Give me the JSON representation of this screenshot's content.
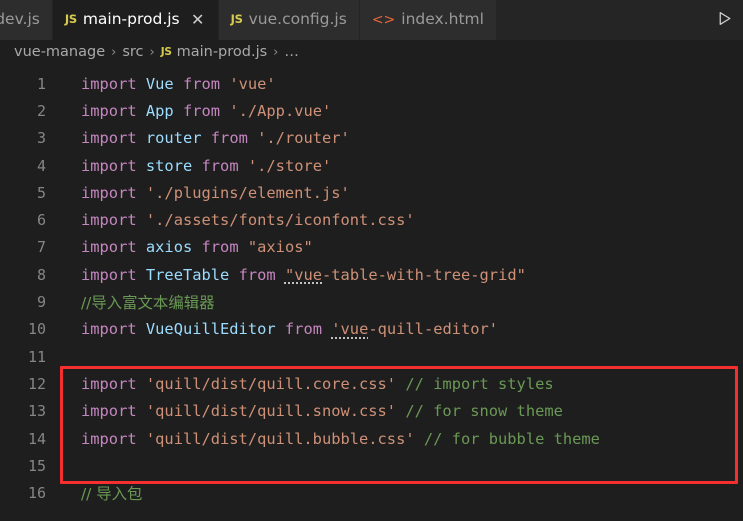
{
  "window": {
    "app": "Visual Studio Code",
    "background": "#1e1e1e"
  },
  "tabbar": {
    "background": "#252526",
    "tabs": [
      {
        "label": "ain-dev.js",
        "icon": "js-file-icon",
        "icon_text": "JS",
        "active": false,
        "clipped": true,
        "closable": false
      },
      {
        "label": "main-prod.js",
        "icon": "js-file-icon",
        "icon_text": "JS",
        "active": true,
        "clipped": false,
        "closable": true
      },
      {
        "label": "vue.config.js",
        "icon": "js-file-icon",
        "icon_text": "JS",
        "active": false,
        "clipped": false,
        "closable": false
      },
      {
        "label": "index.html",
        "icon": "html-file-icon",
        "icon_text": "<>",
        "active": false,
        "clipped": false,
        "closable": false
      }
    ],
    "close_glyph": "✕",
    "run_button_label": "Run",
    "run_icon": "play-triangle-icon"
  },
  "breadcrumb": {
    "separator": "›",
    "items": [
      {
        "label": "vue-manage",
        "icon": null
      },
      {
        "label": "src",
        "icon": null
      },
      {
        "label": "main-prod.js",
        "icon": "js-file-icon",
        "icon_text": "JS"
      },
      {
        "label": "…",
        "icon": null
      }
    ]
  },
  "editor": {
    "language": "javascript",
    "first_visible_line": 1,
    "last_visible_line": 16,
    "colors": {
      "keyword": "#c586c0",
      "variable": "#9cdcfe",
      "string": "#ce9178",
      "comment": "#6a9955",
      "plain": "#d4d4d4",
      "line_number": "#868686",
      "background": "#1e1e1e"
    },
    "lines": [
      {
        "n": "1",
        "tokens": [
          {
            "t": "import",
            "c": "kw"
          },
          {
            "t": " ",
            "c": "plain"
          },
          {
            "t": "Vue",
            "c": "var"
          },
          {
            "t": " ",
            "c": "plain"
          },
          {
            "t": "from",
            "c": "kw"
          },
          {
            "t": " ",
            "c": "plain"
          },
          {
            "t": "'vue'",
            "c": "str"
          }
        ]
      },
      {
        "n": "2",
        "tokens": [
          {
            "t": "import",
            "c": "kw"
          },
          {
            "t": " ",
            "c": "plain"
          },
          {
            "t": "App",
            "c": "var"
          },
          {
            "t": " ",
            "c": "plain"
          },
          {
            "t": "from",
            "c": "kw"
          },
          {
            "t": " ",
            "c": "plain"
          },
          {
            "t": "'./App.vue'",
            "c": "str"
          }
        ]
      },
      {
        "n": "3",
        "tokens": [
          {
            "t": "import",
            "c": "kw"
          },
          {
            "t": " ",
            "c": "plain"
          },
          {
            "t": "router",
            "c": "var"
          },
          {
            "t": " ",
            "c": "plain"
          },
          {
            "t": "from",
            "c": "kw"
          },
          {
            "t": " ",
            "c": "plain"
          },
          {
            "t": "'./router'",
            "c": "str"
          }
        ]
      },
      {
        "n": "4",
        "tokens": [
          {
            "t": "import",
            "c": "kw"
          },
          {
            "t": " ",
            "c": "plain"
          },
          {
            "t": "store",
            "c": "var"
          },
          {
            "t": " ",
            "c": "plain"
          },
          {
            "t": "from",
            "c": "kw"
          },
          {
            "t": " ",
            "c": "plain"
          },
          {
            "t": "'./store'",
            "c": "str"
          }
        ]
      },
      {
        "n": "5",
        "tokens": [
          {
            "t": "import",
            "c": "kw"
          },
          {
            "t": " ",
            "c": "plain"
          },
          {
            "t": "'./plugins/element.js'",
            "c": "str"
          }
        ]
      },
      {
        "n": "6",
        "tokens": [
          {
            "t": "import",
            "c": "kw"
          },
          {
            "t": " ",
            "c": "plain"
          },
          {
            "t": "'./assets/fonts/iconfont.css'",
            "c": "str"
          }
        ]
      },
      {
        "n": "7",
        "tokens": [
          {
            "t": "import",
            "c": "kw"
          },
          {
            "t": " ",
            "c": "plain"
          },
          {
            "t": "axios",
            "c": "var"
          },
          {
            "t": " ",
            "c": "plain"
          },
          {
            "t": "from",
            "c": "kw"
          },
          {
            "t": " ",
            "c": "plain"
          },
          {
            "t": "\"axios\"",
            "c": "str"
          }
        ]
      },
      {
        "n": "8",
        "tokens": [
          {
            "t": "import",
            "c": "kw"
          },
          {
            "t": " ",
            "c": "plain"
          },
          {
            "t": "TreeTable",
            "c": "var"
          },
          {
            "t": " ",
            "c": "plain"
          },
          {
            "t": "from",
            "c": "kw"
          },
          {
            "t": " ",
            "c": "plain"
          },
          {
            "t": "\"vue",
            "c": "str",
            "squiggle": true
          },
          {
            "t": "-table-with-tree-grid\"",
            "c": "str"
          }
        ]
      },
      {
        "n": "9",
        "tokens": [
          {
            "t": "//导入富文本编辑器",
            "c": "com",
            "cjk": true
          }
        ]
      },
      {
        "n": "10",
        "tokens": [
          {
            "t": "import",
            "c": "kw"
          },
          {
            "t": " ",
            "c": "plain"
          },
          {
            "t": "VueQuillEditor",
            "c": "var"
          },
          {
            "t": " ",
            "c": "plain"
          },
          {
            "t": "from",
            "c": "kw"
          },
          {
            "t": " ",
            "c": "plain"
          },
          {
            "t": "'vue",
            "c": "str",
            "squiggle": true
          },
          {
            "t": "-quill-editor'",
            "c": "str"
          }
        ]
      },
      {
        "n": "11",
        "tokens": []
      },
      {
        "n": "12",
        "tokens": [
          {
            "t": "import",
            "c": "kw"
          },
          {
            "t": " ",
            "c": "plain"
          },
          {
            "t": "'quill/dist/quill.core.css'",
            "c": "str"
          },
          {
            "t": " ",
            "c": "plain"
          },
          {
            "t": "// import styles",
            "c": "com"
          }
        ]
      },
      {
        "n": "13",
        "tokens": [
          {
            "t": "import",
            "c": "kw"
          },
          {
            "t": " ",
            "c": "plain"
          },
          {
            "t": "'quill/dist/quill.snow.css'",
            "c": "str"
          },
          {
            "t": " ",
            "c": "plain"
          },
          {
            "t": "// for snow theme",
            "c": "com"
          }
        ]
      },
      {
        "n": "14",
        "tokens": [
          {
            "t": "import",
            "c": "kw"
          },
          {
            "t": " ",
            "c": "plain"
          },
          {
            "t": "'quill/dist/quill.bubble.css'",
            "c": "str"
          },
          {
            "t": " ",
            "c": "plain"
          },
          {
            "t": "// for bubble theme",
            "c": "com"
          }
        ]
      },
      {
        "n": "15",
        "tokens": []
      },
      {
        "n": "16",
        "tokens": [
          {
            "t": "// 导入包",
            "c": "com",
            "cjk": true
          }
        ]
      }
    ]
  },
  "annotation": {
    "shape": "rectangle",
    "color": "#f52f2f",
    "covers_lines": "12-14",
    "border_width_px": 3
  }
}
